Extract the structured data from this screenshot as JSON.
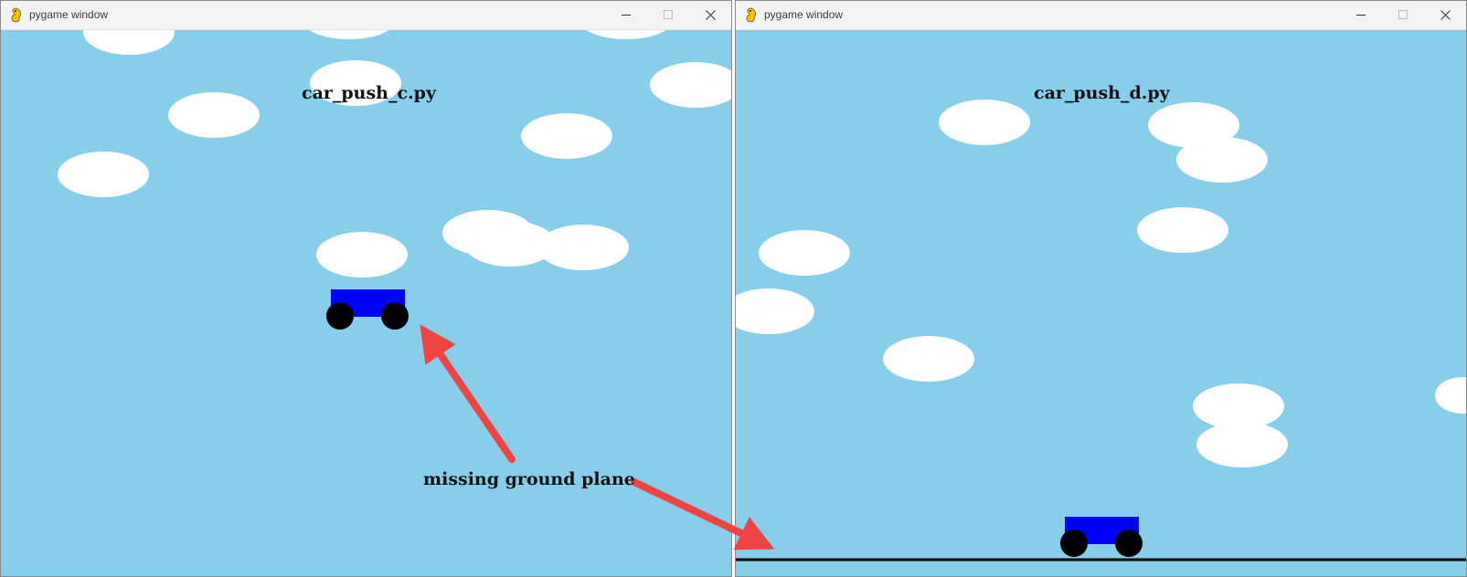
{
  "windows": {
    "left": {
      "title": "pygame window",
      "icon": "pygame-snake-icon",
      "controls": [
        "minimize-icon",
        "maximize-icon",
        "close-icon"
      ],
      "caption": "car_push_c.py",
      "ground_plane": false
    },
    "right": {
      "title": "pygame window",
      "icon": "pygame-snake-icon",
      "controls": [
        "minimize-icon",
        "maximize-icon",
        "close-icon"
      ],
      "caption": "car_push_d.py",
      "ground_plane": true
    }
  },
  "annotation": {
    "text": "missing ground plane",
    "arrow_color": "#ef4444"
  },
  "colors": {
    "sky": "#87ceeb",
    "cloud": "#ffffff",
    "car_body": "#0000ff",
    "wheel": "#000000",
    "ground": "#000000"
  }
}
